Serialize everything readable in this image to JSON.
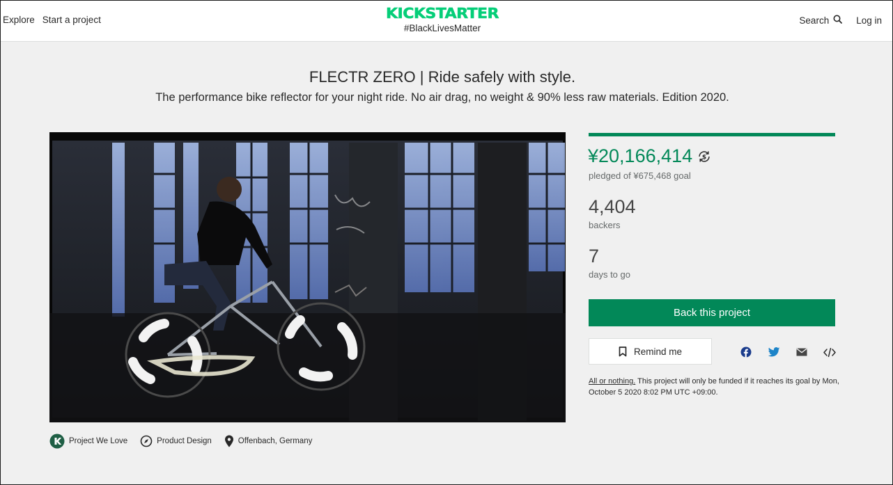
{
  "header": {
    "nav_left": [
      "Explore",
      "Start a project"
    ],
    "logo": "KICKSTARTER",
    "hashtag": "#BlackLivesMatter",
    "search_label": "Search",
    "login_label": "Log in"
  },
  "project": {
    "title": "FLECTR ZERO | Ride safely with style.",
    "subtitle": "The performance bike reflector for your night ride. No air drag, no weight & 90% less raw materials. Edition 2020."
  },
  "tags": [
    {
      "label": "Project We Love",
      "icon": "kickstarter-badge-icon"
    },
    {
      "label": "Product Design",
      "icon": "compass-icon"
    },
    {
      "label": "Offenbach, Germany",
      "icon": "location-pin-icon"
    }
  ],
  "stats": {
    "progress_fraction": 1.0,
    "pledged": "¥20,166,414",
    "goal_text": "pledged of ¥675,468 goal",
    "backers": "4,404",
    "backers_label": "backers",
    "days": "7",
    "days_label": "days to go"
  },
  "actions": {
    "back_label": "Back this project",
    "remind_label": "Remind me",
    "share_icons": [
      "facebook-icon",
      "twitter-icon",
      "email-icon",
      "embed-icon"
    ]
  },
  "fine_print": {
    "link": "All or nothing.",
    "text": " This project will only be funded if it reaches its goal by Mon, October 5 2020 8:02 PM UTC +09:00."
  },
  "colors": {
    "brand_green": "#028858",
    "text": "#282828",
    "muted": "#656969",
    "page_bg": "#f0f0f0"
  }
}
